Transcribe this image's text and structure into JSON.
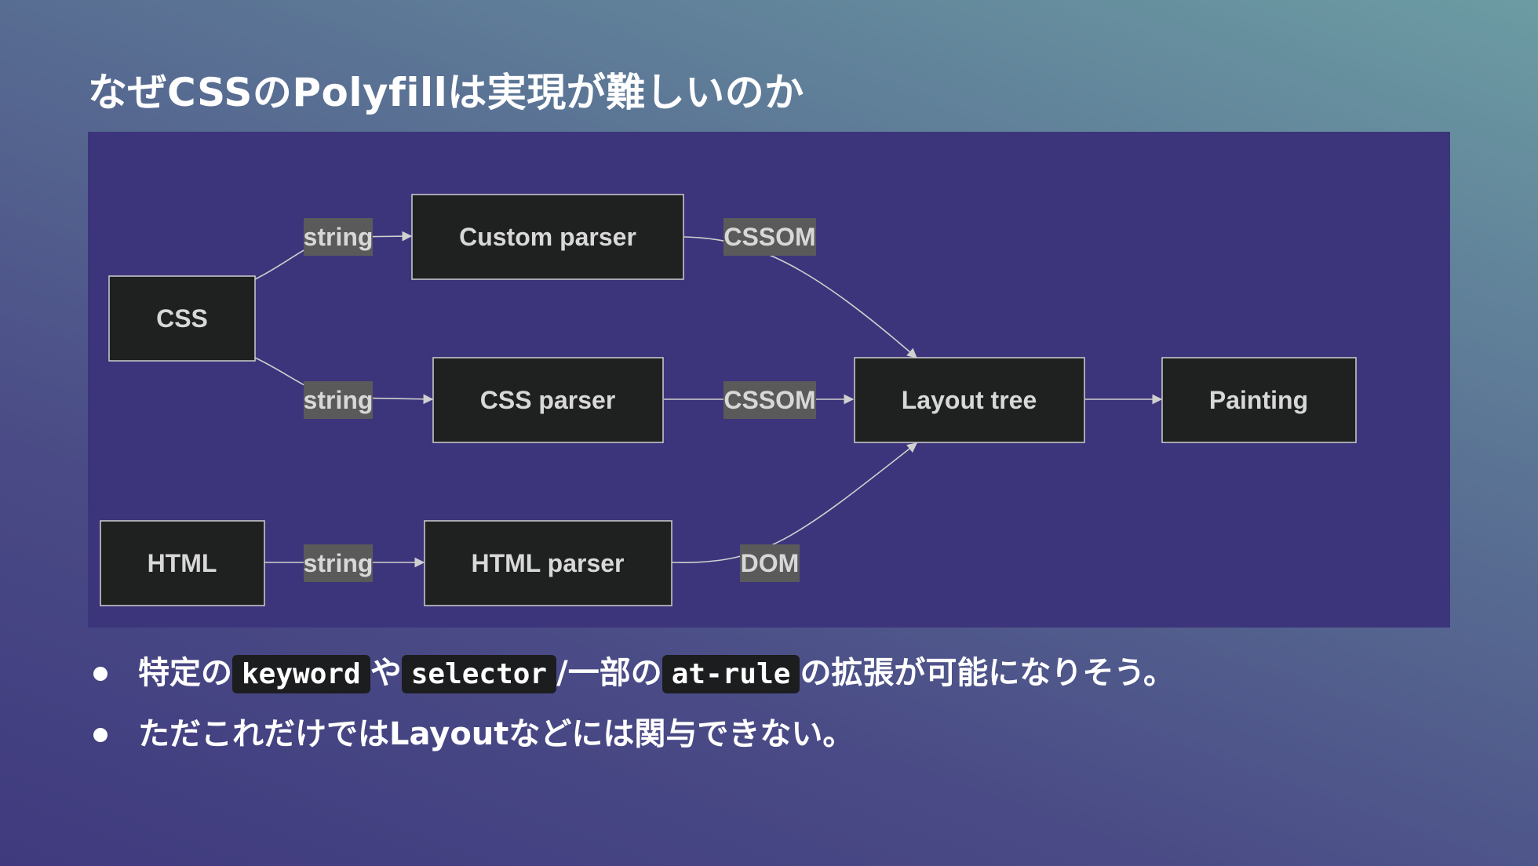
{
  "slide": {
    "title": "なぜCSSのPolyfillは実現が難しいのか"
  },
  "diagram": {
    "nodes": {
      "css": "CSS",
      "custom_parser": "Custom parser",
      "css_parser": "CSS parser",
      "html": "HTML",
      "html_parser": "HTML parser",
      "layout_tree": "Layout tree",
      "painting": "Painting"
    },
    "edges": {
      "css_to_custom": "string",
      "css_to_cssparser": "string",
      "html_to_htmlparser": "string",
      "custom_to_layout": "CSSOM",
      "cssparser_to_layout": "CSSOM",
      "htmlparser_to_layout": "DOM"
    }
  },
  "bullets": [
    {
      "parts": [
        "特定の",
        "keyword",
        "や",
        "selector",
        "/一部の",
        "at-rule",
        "の拡張が可能になりそう。"
      ]
    },
    {
      "parts": [
        "ただこれだけではLayoutなどには関与できない。"
      ]
    }
  ]
}
